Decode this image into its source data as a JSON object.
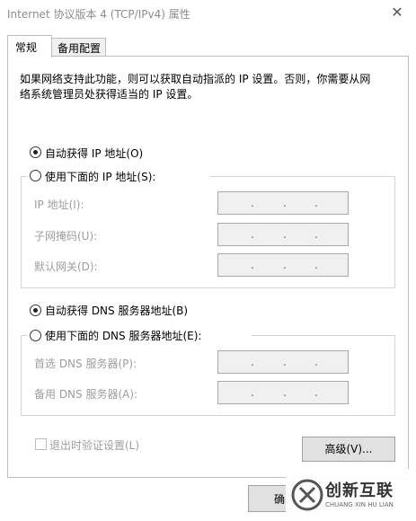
{
  "window": {
    "title": "Internet 协议版本 4 (TCP/IPv4) 属性",
    "close_glyph": "✕"
  },
  "tabs": [
    {
      "label": "常规",
      "active": true
    },
    {
      "label": "备用配置",
      "active": false
    }
  ],
  "description": "如果网络支持此功能，则可以获取自动指派的 IP 设置。否则，你需要从网络系统管理员处获得适当的 IP 设置。",
  "ip_section": {
    "auto_label": "自动获得 IP 地址(O)",
    "auto_checked": true,
    "manual_label": "使用下面的 IP 地址(S):",
    "manual_checked": false,
    "fields": [
      {
        "label": "IP 地址(I):"
      },
      {
        "label": "子网掩码(U):"
      },
      {
        "label": "默认网关(D):"
      }
    ]
  },
  "dns_section": {
    "auto_label": "自动获得 DNS 服务器地址(B)",
    "auto_checked": true,
    "manual_label": "使用下面的 DNS 服务器地址(E):",
    "manual_checked": false,
    "fields": [
      {
        "label": "首选 DNS 服务器(P):"
      },
      {
        "label": "备用 DNS 服务器(A):"
      }
    ]
  },
  "ip_separator": ".",
  "validate_label": "退出时验证设置(L)",
  "validate_checked": false,
  "advanced_button": "高级(V)...",
  "ok_button_partial": "确",
  "watermark": {
    "brand": "创新互联",
    "sub": "CHUANG XIN HU LIAN"
  }
}
